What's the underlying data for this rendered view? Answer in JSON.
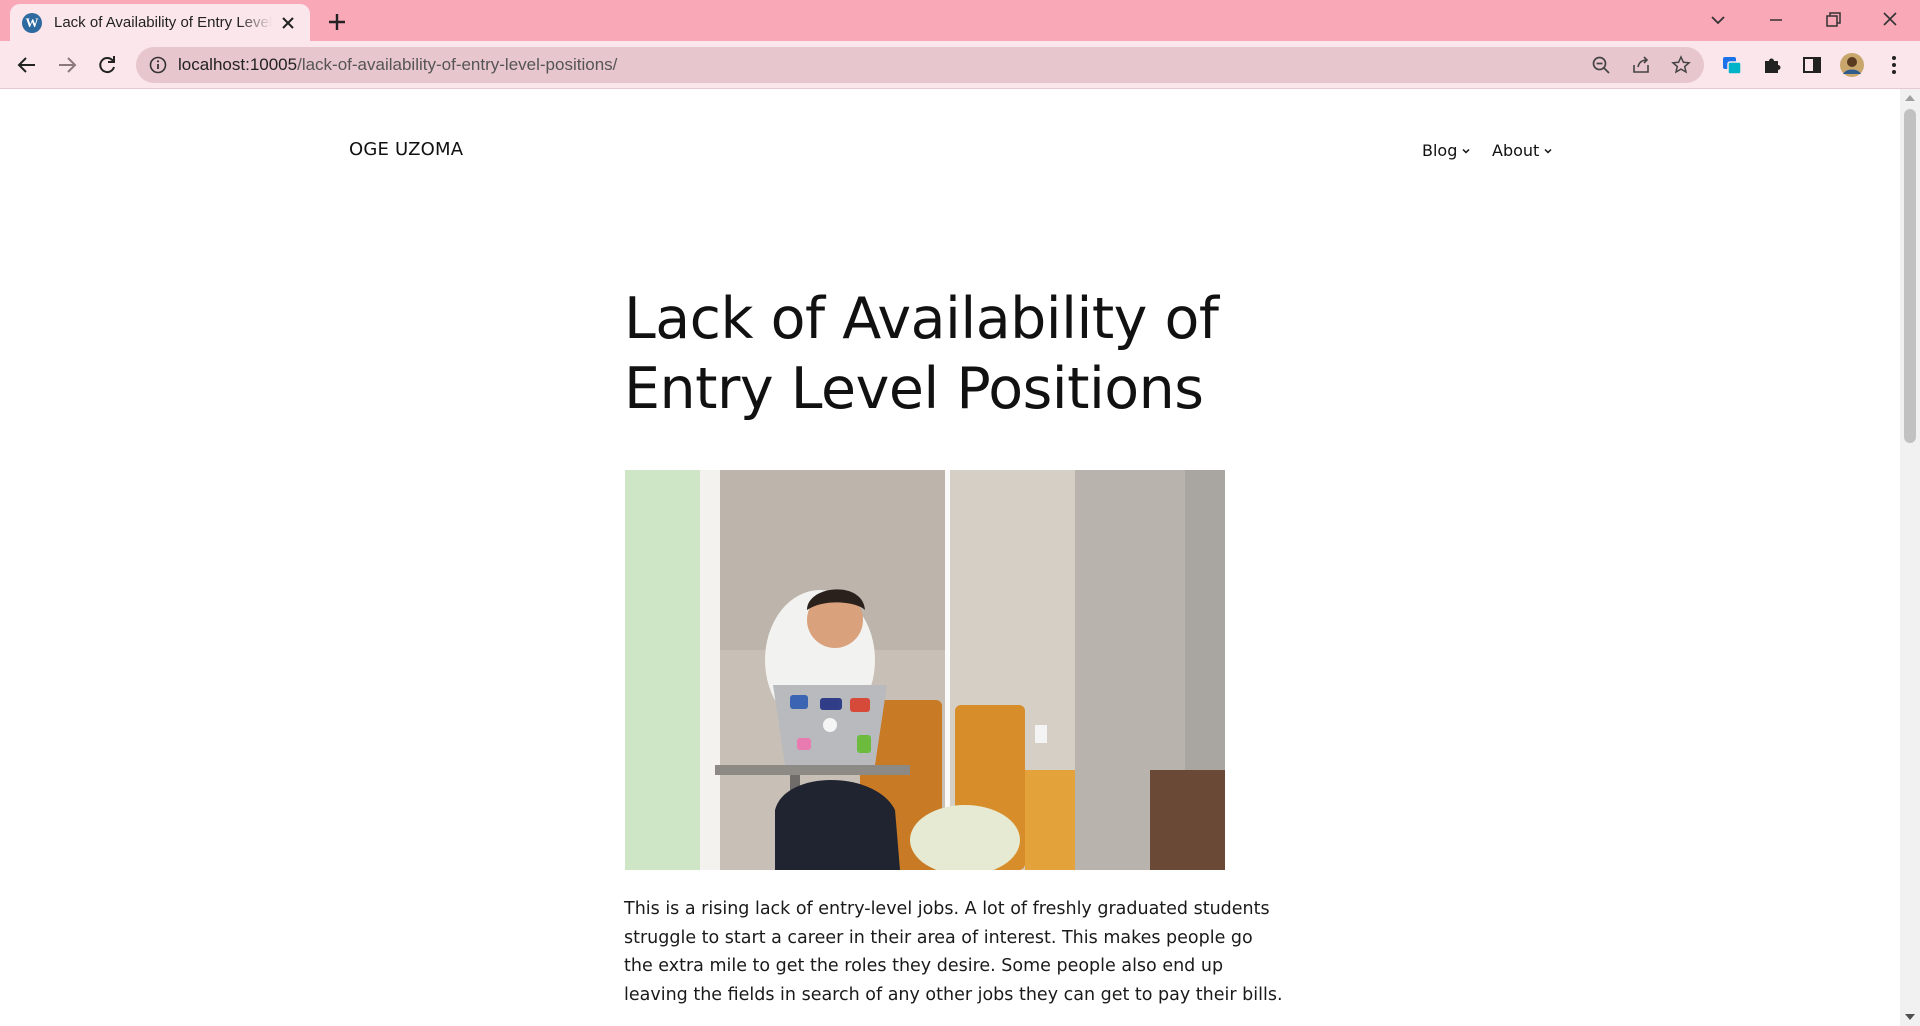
{
  "browser": {
    "tab_title": "Lack of Availability of Entry Level Positions",
    "favicon_letter": "W",
    "url_host": "localhost:10005",
    "url_path": "/lack-of-availability-of-entry-level-positions/",
    "icons": [
      "wordpress-icon",
      "close-icon",
      "plus-icon",
      "chevron-down-icon",
      "minimize-icon",
      "restore-icon",
      "close-window-icon",
      "back-icon",
      "forward-icon",
      "reload-icon",
      "info-icon",
      "zoom-out-icon",
      "share-icon",
      "star-icon",
      "extension-icon",
      "puzzle-icon",
      "sidebar-icon",
      "profile-avatar",
      "more-icon"
    ],
    "theme_color": "#f9a8b8"
  },
  "site": {
    "title": "OGE UZOMA",
    "nav": [
      {
        "label": "Blog"
      },
      {
        "label": "About"
      }
    ]
  },
  "post": {
    "title_line1": "Lack of Availability of",
    "title_line2": "Entry Level Positions",
    "body": "This is a rising lack of entry-level jobs. A lot of freshly graduated students struggle to start a career in their area of interest. This makes people go the extra mile to get the roles they desire. Some people also end up leaving the fields in search of any other jobs they can get to pay their bills."
  }
}
